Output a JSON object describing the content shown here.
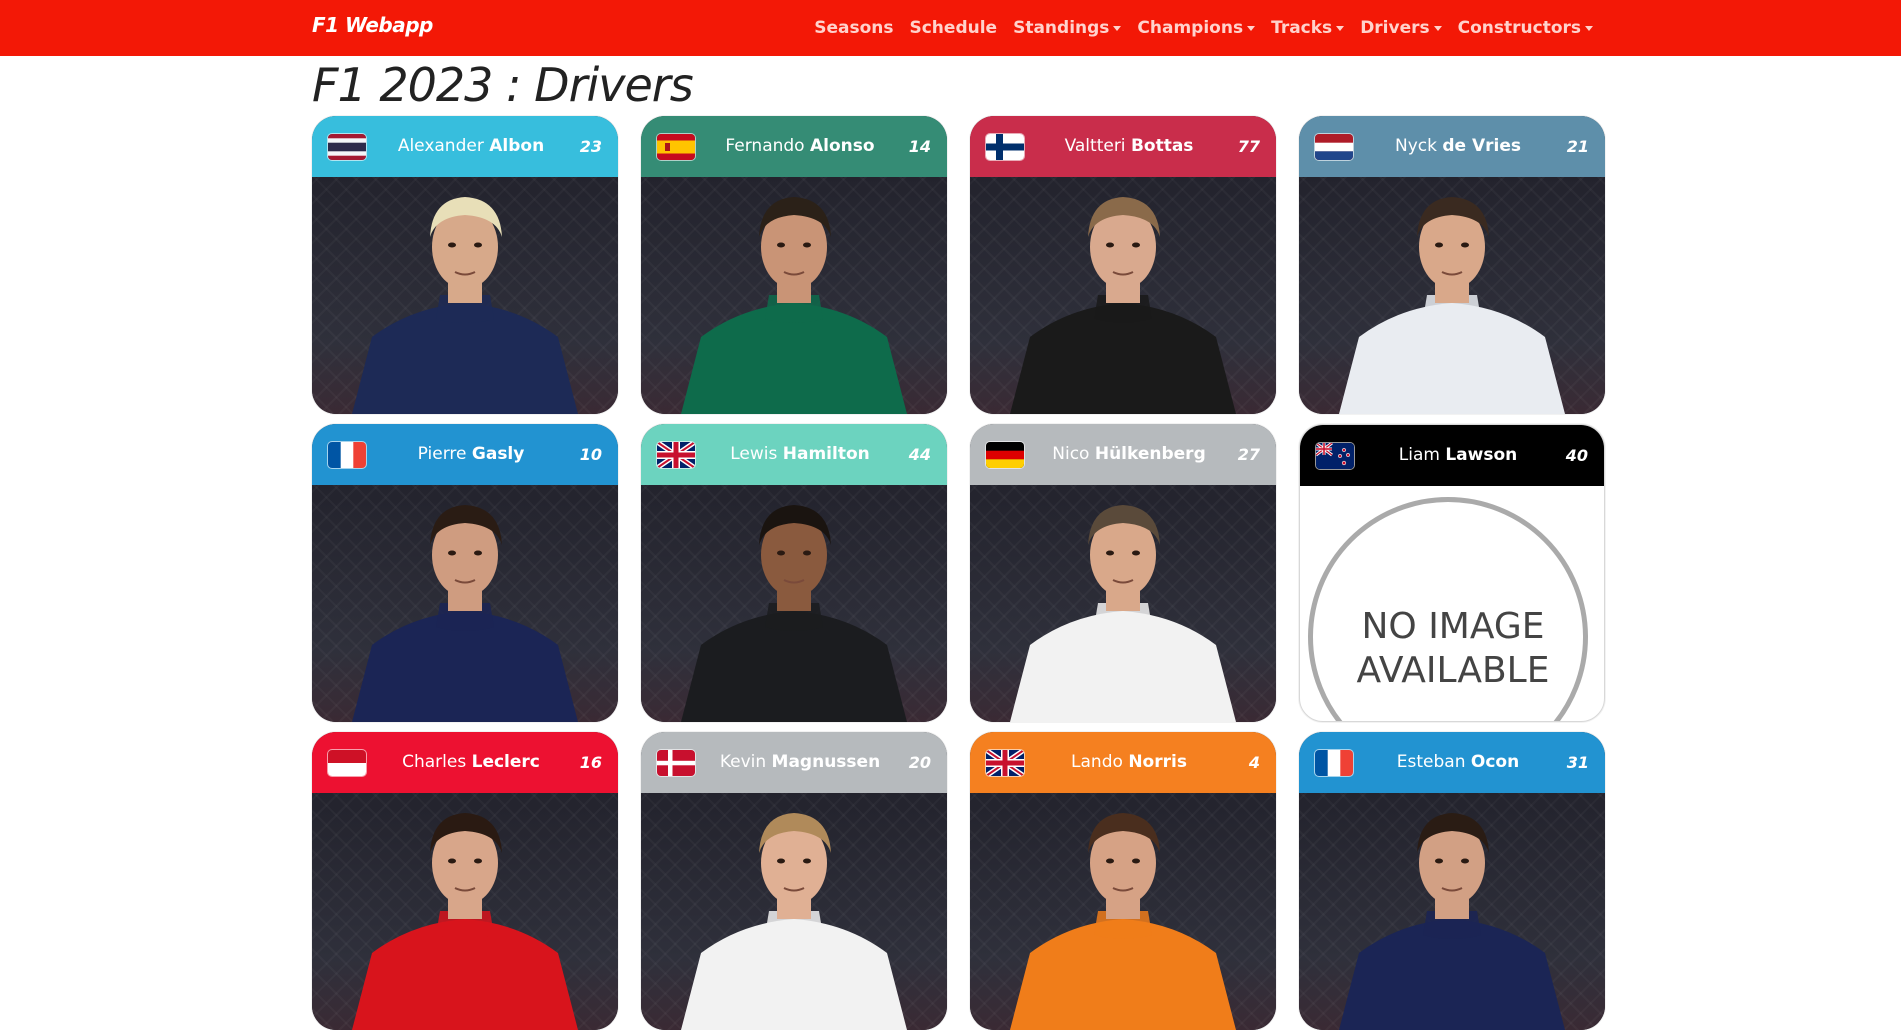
{
  "navbar": {
    "brand": "F1 Webapp",
    "items": [
      {
        "label": "Seasons",
        "dropdown": false
      },
      {
        "label": "Schedule",
        "dropdown": false
      },
      {
        "label": "Standings",
        "dropdown": true
      },
      {
        "label": "Champions",
        "dropdown": true
      },
      {
        "label": "Tracks",
        "dropdown": true
      },
      {
        "label": "Drivers",
        "dropdown": true
      },
      {
        "label": "Constructors",
        "dropdown": true
      }
    ]
  },
  "page": {
    "title": "F1 2023 : Drivers"
  },
  "drivers": [
    {
      "first": "Alexander",
      "last": "Albon",
      "number": "23",
      "color": "#37bedd",
      "flag": "thailand",
      "suit": "#1d2a56",
      "skin": "#d7a98a",
      "hair": "#e8dfb8",
      "image": true
    },
    {
      "first": "Fernando",
      "last": "Alonso",
      "number": "14",
      "color": "#358c75",
      "flag": "spain",
      "suit": "#0e6b4b",
      "skin": "#c99476",
      "hair": "#2b2118",
      "image": true
    },
    {
      "first": "Valtteri",
      "last": "Bottas",
      "number": "77",
      "color": "#c92d4b",
      "flag": "finland",
      "suit": "#1a1a1a",
      "skin": "#d9a98e",
      "hair": "#8a6a4a",
      "image": true
    },
    {
      "first": "Nyck",
      "last": "de Vries",
      "number": "21",
      "color": "#5e8faa",
      "flag": "netherlands",
      "suit": "#e9ecf1",
      "skin": "#d9a88a",
      "hair": "#3a2a20",
      "image": true
    },
    {
      "first": "Pierre",
      "last": "Gasly",
      "number": "10",
      "color": "#2293d1",
      "flag": "france",
      "suit": "#1b2555",
      "skin": "#cf9c80",
      "hair": "#2a1c14",
      "image": true
    },
    {
      "first": "Lewis",
      "last": "Hamilton",
      "number": "44",
      "color": "#6cd3bf",
      "flag": "uk",
      "suit": "#1b1c1f",
      "skin": "#8a5a3e",
      "hair": "#1a1410",
      "image": true
    },
    {
      "first": "Nico",
      "last": "Hülkenberg",
      "number": "27",
      "color": "#b6babd",
      "flag": "germany",
      "suit": "#f2f2f2",
      "skin": "#d9a88a",
      "hair": "#5a4a3a",
      "image": true
    },
    {
      "first": "Liam",
      "last": "Lawson",
      "number": "40",
      "color": "#000000",
      "flag": "newzealand",
      "image": false,
      "no_image_line1": "NO IMAGE",
      "no_image_line2": "AVAILABLE"
    },
    {
      "first": "Charles",
      "last": "Leclerc",
      "number": "16",
      "color": "#ed1131",
      "flag": "monaco",
      "suit": "#d8141c",
      "skin": "#d8a68a",
      "hair": "#2a1a12",
      "image": true
    },
    {
      "first": "Kevin",
      "last": "Magnussen",
      "number": "20",
      "color": "#b6babd",
      "flag": "denmark",
      "suit": "#f2f2f2",
      "skin": "#e0b094",
      "hair": "#b08a5a",
      "image": true
    },
    {
      "first": "Lando",
      "last": "Norris",
      "number": "4",
      "color": "#f58020",
      "flag": "uk",
      "suit": "#f07d1a",
      "skin": "#d6a285",
      "hair": "#4a2e1e",
      "image": true
    },
    {
      "first": "Esteban",
      "last": "Ocon",
      "number": "31",
      "color": "#2293d1",
      "flag": "france",
      "suit": "#1b2555",
      "skin": "#d2a084",
      "hair": "#2a1c14",
      "image": true
    }
  ]
}
